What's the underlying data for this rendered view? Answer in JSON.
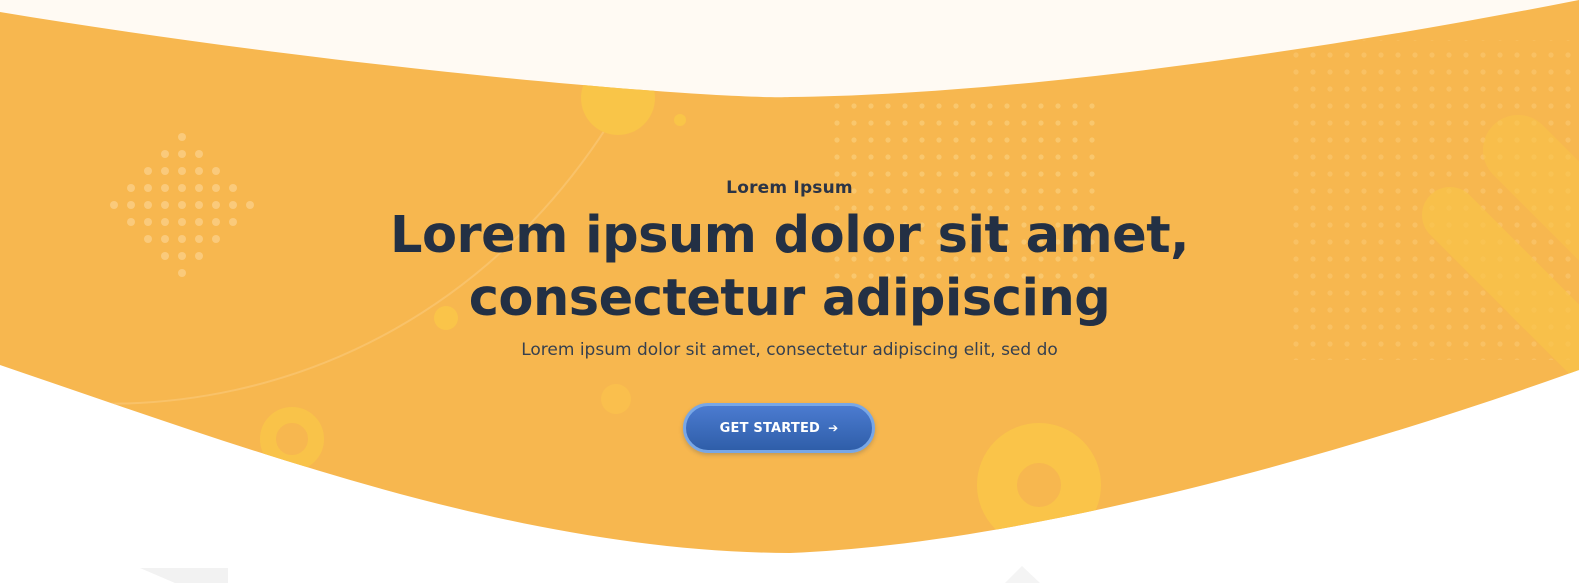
{
  "hero": {
    "eyebrow": "Lorem Ipsum",
    "title_line1": "Lorem ipsum dolor sit amet,",
    "title_line2": "consectetur adipiscing",
    "subtitle": "Lorem ipsum dolor sit amet, consectetur adipiscing elit, sed do",
    "cta_label": "GET STARTED",
    "cta_icon": "arrow-right-icon"
  },
  "colors": {
    "hero_bg": "#f7b74f",
    "top_bg": "#fffaf3",
    "heading": "#233044",
    "button": "#3a68b8",
    "button_border": "#78a7e6"
  }
}
